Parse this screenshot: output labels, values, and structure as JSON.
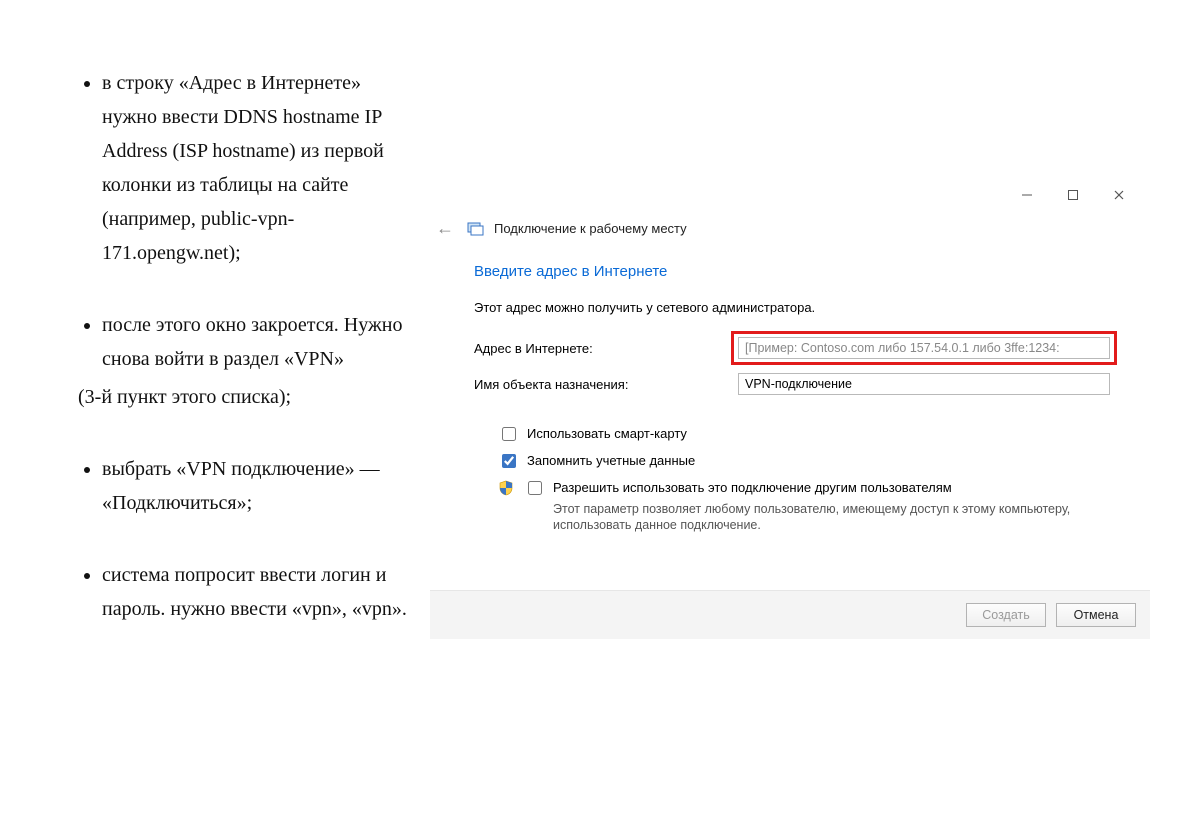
{
  "doc": {
    "items": [
      {
        "text": "в строку «Адрес в Интернете» нужно ввести DDNS hostname IP Address (ISP hostname) из первой колонки из таблицы на сайте (например, public-vpn-171.opengw.net);"
      },
      {
        "text": "после этого окно закроется. Нужно снова войти в раздел «VPN»",
        "subline": "(3-й пункт этого списка);"
      },
      {
        "text": "выбрать «VPN подключение» — «Подключиться»;"
      },
      {
        "text": "система попросит ввести логин и пароль. нужно ввести «vpn», «vpn»."
      }
    ]
  },
  "dialog": {
    "header_title": "Подключение к рабочему месту",
    "lead": "Введите адрес в Интернете",
    "info": "Этот адрес можно получить у сетевого администратора.",
    "address_label": "Адрес в Интернете:",
    "address_placeholder": "[Пример: Contoso.com либо 157.54.0.1 либо 3ffe:1234:",
    "dest_label": "Имя объекта назначения:",
    "dest_value": "VPN-подключение",
    "smartcard_label": "Использовать смарт-карту",
    "remember_label": "Запомнить учетные данные",
    "allow_label": "Разрешить использовать это подключение другим пользователям",
    "allow_desc": "Этот параметр позволяет любому пользователю, имеющему доступ к этому компьютеру, использовать данное подключение.",
    "create_btn": "Создать",
    "cancel_btn": "Отмена",
    "smartcard_checked": false,
    "remember_checked": true,
    "allow_checked": false
  }
}
